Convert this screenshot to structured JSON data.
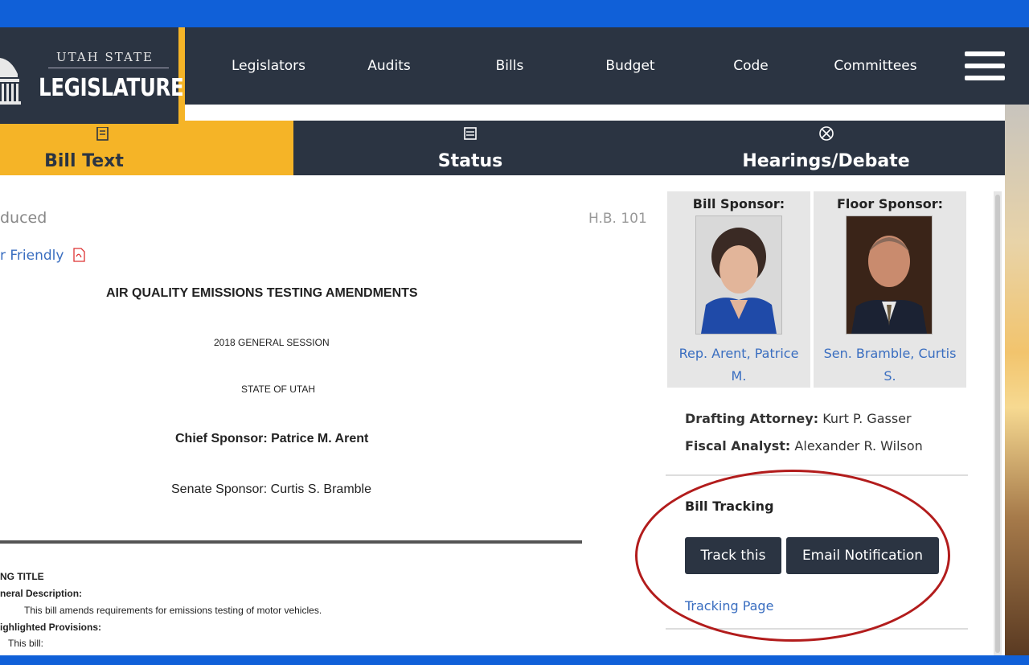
{
  "header": {
    "logo_small": "UTAH STATE",
    "logo_big": "LEGISLATURE",
    "nav": [
      "Legislators",
      "Audits",
      "Bills",
      "Budget",
      "Code",
      "Committees"
    ]
  },
  "tabs": [
    {
      "label": "Bill Text",
      "icon": "document-icon",
      "active": true
    },
    {
      "label": "Status",
      "icon": "list-icon",
      "active": false
    },
    {
      "label": "Hearings/Debate",
      "icon": "gavel-icon",
      "active": false
    }
  ],
  "document": {
    "status_fragment": "duced",
    "bill_number": "H.B. 101",
    "printer_link": "r Friendly",
    "title": "AIR QUALITY EMISSIONS TESTING AMENDMENTS",
    "session": "2018 GENERAL SESSION",
    "state": "STATE OF UTAH",
    "chief_sponsor": "Chief Sponsor: Patrice M. Arent",
    "senate_sponsor": "Senate Sponsor: Curtis S. Bramble",
    "long_title": "NG TITLE",
    "general_desc_label": "neral Description:",
    "general_desc": "This bill amends requirements for emissions testing of motor vehicles.",
    "highlighted_label": "ighlighted Provisions:",
    "this_bill": "This bill:"
  },
  "sidebar": {
    "bill_sponsor_title": "Bill Sponsor:",
    "bill_sponsor_name_l1": "Rep. Arent, Patrice",
    "bill_sponsor_name_l2": "M.",
    "floor_sponsor_title": "Floor Sponsor:",
    "floor_sponsor_name_l1": "Sen. Bramble, Curtis",
    "floor_sponsor_name_l2": "S.",
    "drafting_label": "Drafting Attorney:",
    "drafting_value": "Kurt P. Gasser",
    "fiscal_label": "Fiscal Analyst:",
    "fiscal_value": "Alexander R. Wilson",
    "tracking_heading": "Bill Tracking",
    "track_button": "Track this",
    "email_button": "Email Notification",
    "tracking_page_link": "Tracking Page"
  },
  "colors": {
    "navy": "#2b3442",
    "gold": "#f5b427",
    "link": "#3a6ec0",
    "frame_blue": "#1060d8",
    "annotation_red": "#b21c1c"
  }
}
